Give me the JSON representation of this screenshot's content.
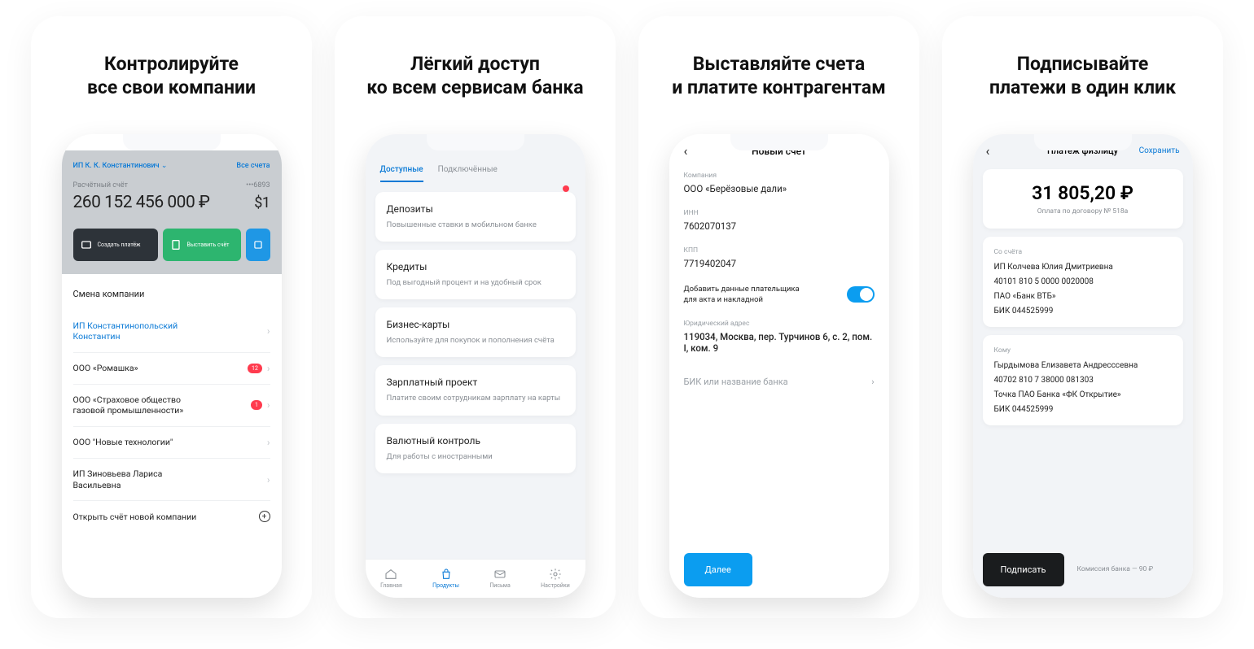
{
  "panel1": {
    "headline_l1": "Контролируйте",
    "headline_l2": "все свои компании",
    "company": "ИП К. К. Константинович",
    "all_accounts": "Все счета",
    "acc_label": "Расчётный счёт",
    "acc_tail": "•••6893",
    "balance": "260 152 456 000 ₽",
    "balance2": "$1",
    "btn_create": "Создать платёж",
    "btn_invoice": "Выставить счёт",
    "sheet_title": "Смена компании",
    "items": [
      {
        "name": "ИП Константинопольский Константин",
        "active": true
      },
      {
        "name": "ООО «Ромашка»",
        "badge": "12"
      },
      {
        "name": "ООО «Страховое общество газовой промышленности»",
        "badge": "1"
      },
      {
        "name": "ООО \"Новые технологии\""
      },
      {
        "name": "ИП Зиновьева Лариса Васильевна"
      }
    ],
    "open_new": "Открыть счёт новой компании"
  },
  "panel2": {
    "headline_l1": "Лёгкий доступ",
    "headline_l2": "ко всем сервисам банка",
    "tab_active": "Доступные",
    "tab_other": "Подключённые",
    "cards": [
      {
        "title": "Депозиты",
        "desc": "Повышенные ставки в мобильном банке"
      },
      {
        "title": "Кредиты",
        "desc": "Под выгодный процент и на удобный срок"
      },
      {
        "title": "Бизнес-карты",
        "desc": "Используйте для покупок и пополнения счёта"
      },
      {
        "title": "Зарплатный проект",
        "desc": "Платите своим сотрудникам зарплату на карты"
      },
      {
        "title": "Валютный контроль",
        "desc": "Для работы с иностранными"
      }
    ],
    "nav": [
      "Главная",
      "Продукты",
      "Письма",
      "Настройки"
    ]
  },
  "panel3": {
    "headline_l1": "Выставляйте счета",
    "headline_l2": "и платите контрагентам",
    "title": "Новый счёт",
    "company_label": "Компания",
    "company": "ООО «Берёзовые дали»",
    "inn_label": "ИНН",
    "inn": "7602070137",
    "kpp_label": "КПП",
    "kpp": "7719402047",
    "toggle_label": "Добавить данные плательщика для акта и накладной",
    "addr_label": "Юридический адрес",
    "addr": "119034, Москва, пер. Турчинов 6, с. 2, пом. I, ком. 9",
    "bik_placeholder": "БИК или название банка",
    "next": "Далее"
  },
  "panel4": {
    "headline_l1": "Подписывайте",
    "headline_l2": "платежи в один клик",
    "title": "Платёж физлицу",
    "save": "Сохранить",
    "amount": "31 805,20 ₽",
    "amount_sub": "Оплата по договору № 518а",
    "from_label": "Со счёта",
    "from_lines": [
      "ИП Колчева Юлия Дмитриевна",
      "40101 810 5 0000 0020008",
      "ПАО «Банк ВТБ»",
      "БИК 044525999"
    ],
    "to_label": "Кому",
    "to_lines": [
      "Гырдымова Елизавета Андресссевна",
      "40702 810 7 38000 081303",
      "Точка ПАО Банка «ФК Открытие»",
      "БИК 044525999"
    ],
    "sign": "Подписать",
    "fee": "Комиссия банка — 90 ₽"
  }
}
